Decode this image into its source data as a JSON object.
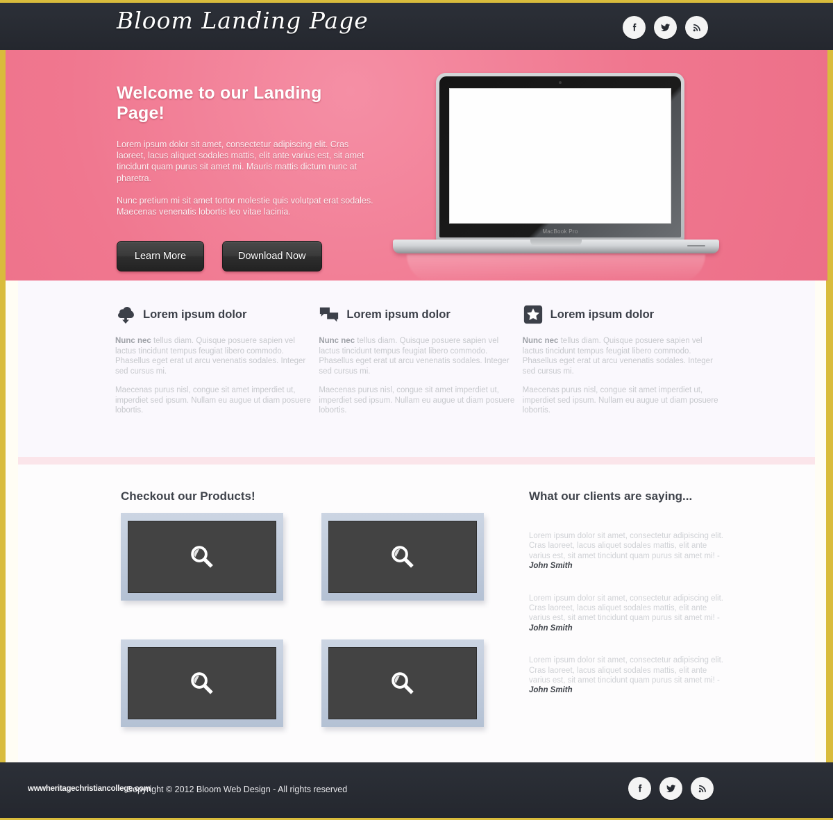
{
  "colors": {
    "gold_border": "#d9bc3c",
    "header_dark": "#282c34",
    "hero_pink": "#f0778f",
    "feature_bg": "#faf8fd",
    "pink_divider": "#fbe5ea",
    "product_frame": "#c2cddd",
    "product_inner": "#434343"
  },
  "header": {
    "brand": "Bloom Landing Page",
    "social": [
      {
        "name": "facebook-icon",
        "label": "Facebook"
      },
      {
        "name": "twitter-icon",
        "label": "Twitter"
      },
      {
        "name": "rss-icon",
        "label": "RSS"
      }
    ]
  },
  "hero": {
    "title": "Welcome to our Landing Page!",
    "paragraph1": "Lorem ipsum dolor sit amet, consectetur adipiscing elit. Cras laoreet, lacus aliquet sodales mattis, elit ante varius est, sit amet tincidunt quam purus sit amet mi. Mauris mattis dictum nunc at pharetra.",
    "paragraph2": "Nunc pretium mi sit amet tortor molestie quis volutpat erat sodales. Maecenas venenatis lobortis leo vitae lacinia.",
    "primary_button": "Learn More",
    "secondary_button": "Download Now",
    "laptop_label": "MacBook Pro"
  },
  "features": [
    {
      "icon": "cloud-download-icon",
      "title": "Lorem ipsum dolor",
      "lead": "Nunc nec",
      "paragraph1": " tellus diam. Quisque posuere sapien vel lactus tincidunt tempus feugiat libero commodo. Phasellus eget erat ut arcu venenatis sodales. Integer sed cursus mi.",
      "paragraph2": "Maecenas purus nisl, congue sit amet imperdiet ut, imperdiet sed ipsum. Nullam eu augue ut diam posuere lobortis."
    },
    {
      "icon": "chat-bubbles-icon",
      "title": "Lorem ipsum dolor",
      "lead": "Nunc nec",
      "paragraph1": " tellus diam. Quisque posuere sapien vel lactus tincidunt tempus feugiat libero commodo. Phasellus eget erat ut arcu venenatis sodales. Integer sed cursus mi.",
      "paragraph2": "Maecenas purus nisl, congue sit amet imperdiet ut, imperdiet sed ipsum. Nullam eu augue ut diam posuere lobortis."
    },
    {
      "icon": "star-badge-icon",
      "title": "Lorem ipsum dolor",
      "lead": "Nunc nec",
      "paragraph1": " tellus diam. Quisque posuere sapien vel lactus tincidunt tempus feugiat libero commodo. Phasellus eget erat ut arcu venenatis sodales. Integer sed cursus mi.",
      "paragraph2": "Maecenas purus nisl, congue sit amet imperdiet ut, imperdiet sed ipsum. Nullam eu augue ut diam posuere lobortis."
    }
  ],
  "products": {
    "title": "Checkout our Products!",
    "items": [
      {
        "icon": "magnifier-icon"
      },
      {
        "icon": "magnifier-icon"
      },
      {
        "icon": "magnifier-icon"
      },
      {
        "icon": "magnifier-icon"
      }
    ]
  },
  "testimonials": {
    "title": "What our clients are saying...",
    "items": [
      {
        "quote": "Lorem ipsum dolor sit amet, consectetur adipiscing elit. Cras laoreet, lacus aliquet sodales mattis, elit ante varius est, sit amet tincidunt quam purus sit amet mi! - ",
        "author": "John Smith"
      },
      {
        "quote": "Lorem ipsum dolor sit amet, consectetur adipiscing elit. Cras laoreet, lacus aliquet sodales mattis, elit ante varius est, sit amet tincidunt quam purus sit amet mi! - ",
        "author": "John Smith"
      },
      {
        "quote": "Lorem ipsum dolor sit amet, consectetur adipiscing elit. Cras laoreet, lacus aliquet sodales mattis, elit ante varius est, sit amet tincidunt quam purus sit amet mi! - ",
        "author": "John Smith"
      }
    ]
  },
  "footer": {
    "watermark": "wwwheritagechristiancollege.com",
    "copyright": "Copyright © 2012 Bloom Web Design - All rights reserved",
    "social": [
      {
        "name": "facebook-icon",
        "label": "Facebook"
      },
      {
        "name": "twitter-icon",
        "label": "Twitter"
      },
      {
        "name": "rss-icon",
        "label": "RSS"
      }
    ]
  }
}
